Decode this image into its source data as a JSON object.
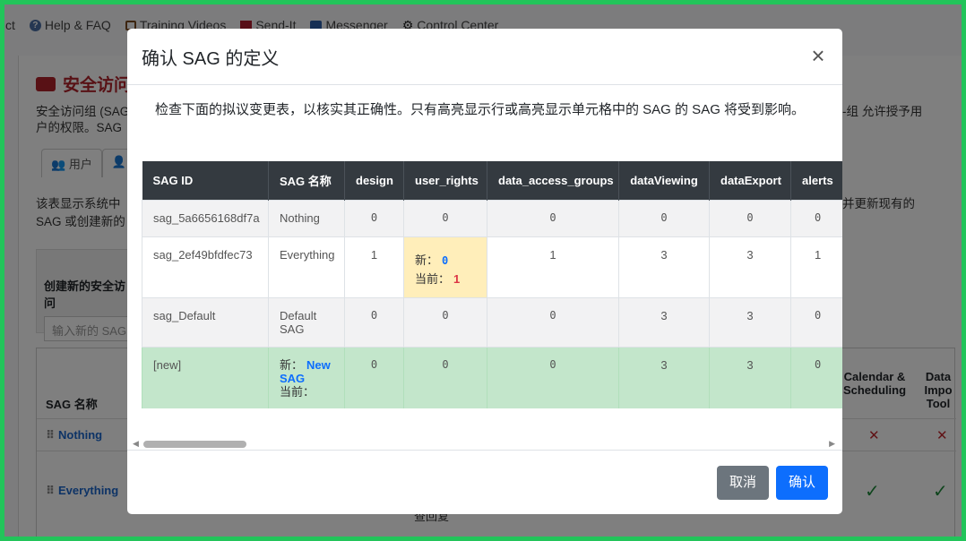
{
  "topnav": {
    "partial_first": "ct",
    "items": [
      {
        "label": "Help & FAQ",
        "icon": "question-circle-icon"
      },
      {
        "label": "Training Videos",
        "icon": "film-icon"
      },
      {
        "label": "Send-It",
        "icon": "envelope-icon"
      },
      {
        "label": "Messenger",
        "icon": "message-icon"
      },
      {
        "label": "Control Center",
        "icon": "gear-icon"
      }
    ]
  },
  "background": {
    "title": "安全访问",
    "desc_line1": "安全访问组 (SAG",
    "desc_line2": "户的权限。SAG ",
    "desc_right": "-组 允许授予用",
    "tab_users": "用户",
    "desc2_line1": "该表显示系统中",
    "desc2_line2": "SAG 或创建新的",
    "desc2_right": "并更新现有的",
    "create_label": "创建新的安全访问",
    "create_placeholder": "输入新的 SAG",
    "table_header_name": "SAG 名称",
    "col_calendar": "Calendar & Scheduling",
    "col_data_import": "Data Impo Tool",
    "row1": "Nothing",
    "row2": "Everything",
    "bottom_text": "查回复"
  },
  "modal": {
    "title": "确认 SAG 的定义",
    "intro": "检查下面的拟议变更表，以核实其正确性。只有高亮显示行或高亮显示单元格中的 SAG 的 SAG 将受到影响。",
    "columns": [
      "SAG ID",
      "SAG 名称",
      "design",
      "user_rights",
      "data_access_groups",
      "dataViewing",
      "dataExport",
      "alerts"
    ],
    "rows": [
      {
        "id": "sag_5a6656168df7a",
        "name": "Nothing",
        "design": "0",
        "user_rights": "0",
        "data_access_groups": "0",
        "dataViewing": "0",
        "dataExport": "0",
        "alerts": "0"
      },
      {
        "id": "sag_2ef49bfdfec73",
        "name": "Everything",
        "design": "1",
        "user_rights_new_label": "新：",
        "user_rights_new": "0",
        "user_rights_cur_label": "当前：",
        "user_rights_cur": "1",
        "data_access_groups": "1",
        "dataViewing": "3",
        "dataExport": "3",
        "alerts": "1"
      },
      {
        "id": "sag_Default",
        "name": "Default SAG",
        "design": "0",
        "user_rights": "0",
        "data_access_groups": "0",
        "dataViewing": "3",
        "dataExport": "3",
        "alerts": "0"
      },
      {
        "id": "[new]",
        "name_new_label": "新：",
        "name_new": "New SAG",
        "name_cur_label": "当前：",
        "design": "0",
        "user_rights": "0",
        "data_access_groups": "0",
        "dataViewing": "3",
        "dataExport": "3",
        "alerts": "0"
      }
    ],
    "cancel_label": "取消",
    "confirm_label": "确认"
  },
  "colors": {
    "header_bg": "#343a40",
    "new_row_bg": "#c3e6cb",
    "highlight_cell_bg": "#ffeeba",
    "primary": "#0d6efd",
    "frame": "#22c45a"
  }
}
